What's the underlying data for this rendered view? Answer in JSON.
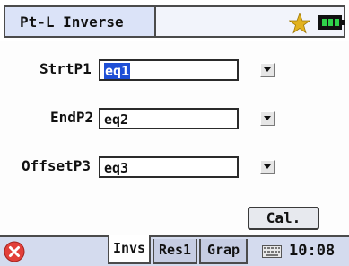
{
  "titlebar": {
    "title": "Pt-L Inverse"
  },
  "form": {
    "fields": [
      {
        "label": "StrtP1",
        "value": "eq1"
      },
      {
        "label": "EndP2",
        "value": "eq2"
      },
      {
        "label": "OffsetP3",
        "value": "eq3"
      }
    ],
    "calculate_label": "Cal."
  },
  "tabs": [
    {
      "label": "Invs",
      "active": true
    },
    {
      "label": "Res1",
      "active": false
    },
    {
      "label": "Grap",
      "active": false
    }
  ],
  "status": {
    "time": "10:08"
  },
  "icons": [
    "star-icon",
    "battery-icon",
    "close-icon",
    "keyboard-icon",
    "dropdown-arrow-icon"
  ],
  "colors": {
    "title_bg": "#dbe3f8",
    "selection": "#1e4fd6",
    "bottom_bar": "#d4dbee",
    "close_red": "#e2403a",
    "star": "#e2b21f",
    "battery": "#2fd34a"
  }
}
